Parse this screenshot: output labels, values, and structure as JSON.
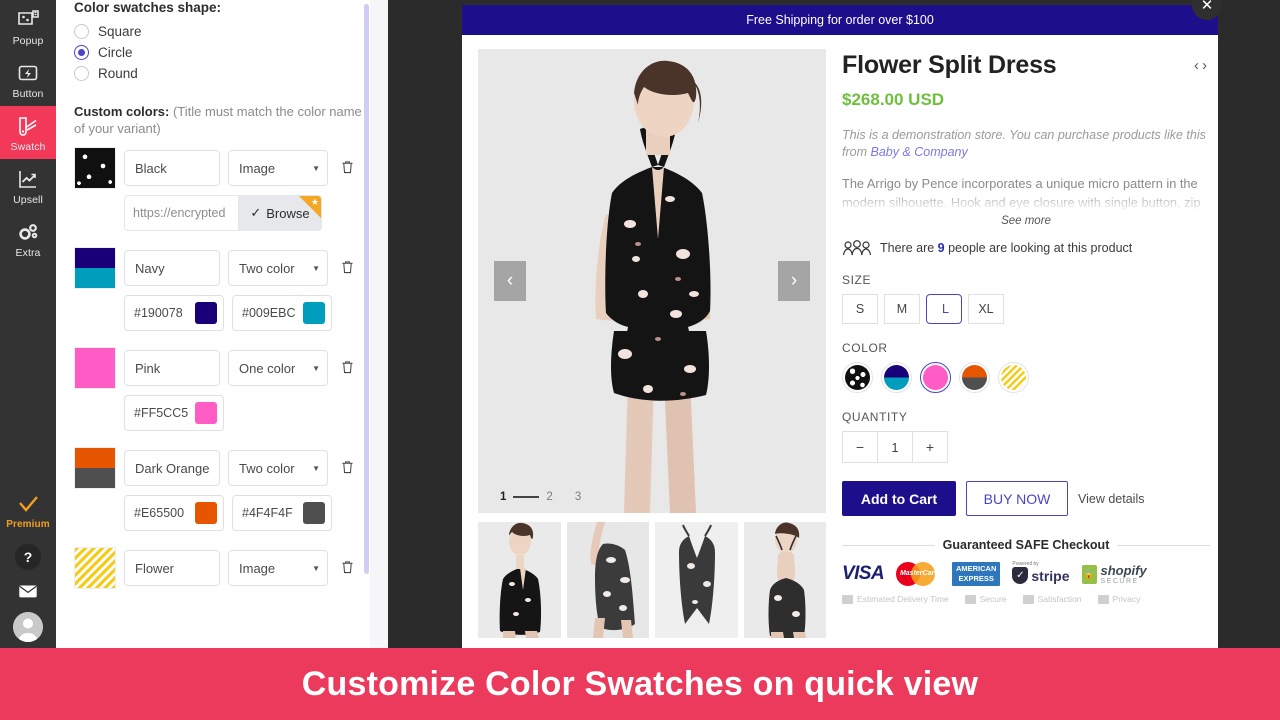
{
  "rail": {
    "items": [
      {
        "label": "Popup",
        "icon": "popup-icon",
        "active": false
      },
      {
        "label": "Button",
        "icon": "button-icon",
        "active": false
      },
      {
        "label": "Swatch",
        "icon": "swatch-icon",
        "active": true
      },
      {
        "label": "Upsell",
        "icon": "upsell-icon",
        "active": false
      },
      {
        "label": "Extra",
        "icon": "extra-icon",
        "active": false
      }
    ],
    "premium_label": "Premium",
    "help_label": "?",
    "active_color": "#f2395a",
    "premium_color": "#f0a020"
  },
  "panel": {
    "shape_title": "Color swatches shape:",
    "shape_options": [
      {
        "label": "Square",
        "selected": false
      },
      {
        "label": "Circle",
        "selected": true
      },
      {
        "label": "Round",
        "selected": false
      }
    ],
    "custom_label": "Custom colors:",
    "custom_hint": "(Title must match the color name of your variant)",
    "select_caret": "▼",
    "trash_icon": "🗑",
    "browse_label": "Browse",
    "browse_check": "✓",
    "rows": [
      {
        "title": "Black",
        "type": "Image",
        "preview": "black-flower-pattern",
        "url": "https://encrypted",
        "hex1": null,
        "hex2": null,
        "color1": "#111111",
        "color2": null
      },
      {
        "title": "Navy",
        "type": "Two color",
        "preview": "two-color",
        "url": null,
        "hex1": "#190078",
        "hex2": "#009EBC",
        "color1": "#190078",
        "color2": "#009EBC"
      },
      {
        "title": "Pink",
        "type": "One color",
        "preview": "one-color",
        "url": null,
        "hex1": "#FF5CC5",
        "hex2": null,
        "color1": "#FF5CC5",
        "color2": null
      },
      {
        "title": "Dark Orange",
        "type": "Two color",
        "preview": "two-color",
        "url": null,
        "hex1": "#E65500",
        "hex2": "#4F4F4F",
        "color1": "#E65500",
        "color2": "#4F4F4F"
      },
      {
        "title": "Flower",
        "type": "Image",
        "preview": "yellow-zigzag-pattern",
        "url": null,
        "hex1": null,
        "hex2": null,
        "color1": "#f5cc1a",
        "color2": null
      }
    ]
  },
  "modal": {
    "close_icon": "✕",
    "shipping_banner": "Free Shipping for order over $100",
    "gallery": {
      "prev_icon": "‹",
      "next_icon": "›",
      "pager": {
        "current": "1",
        "others": [
          "2",
          "3"
        ]
      },
      "thumbnails": [
        "front-full",
        "side-detail",
        "flat-lay",
        "back-view"
      ]
    },
    "product": {
      "title": "Flower Split Dress",
      "nav_prev": "‹",
      "nav_next": "›",
      "price": "$268.00 USD",
      "price_color": "#6fbf3f",
      "demo_text": "This is a demonstration store. You can purchase products like this from ",
      "demo_link": "Baby & Company",
      "description": "The Arrigo by Pence incorporates a unique micro pattern in the modern silhouette. Hook and eye closure with single button, zip fly",
      "see_more": "See more",
      "watchers_prefix": "There are ",
      "watchers_count": "9",
      "watchers_suffix": " people are looking at this product",
      "size_label": "SIZE",
      "sizes": [
        {
          "label": "S",
          "selected": false
        },
        {
          "label": "M",
          "selected": false
        },
        {
          "label": "L",
          "selected": true
        },
        {
          "label": "XL",
          "selected": false
        }
      ],
      "color_label": "COLOR",
      "colors": [
        {
          "name": "Black",
          "kind": "image-black-flower",
          "selected": false
        },
        {
          "name": "Navy",
          "kind": "two",
          "c1": "#190078",
          "c2": "#009EBC",
          "selected": false
        },
        {
          "name": "Pink",
          "kind": "one",
          "c1": "#FF5CC5",
          "selected": true
        },
        {
          "name": "Dark Orange",
          "kind": "two",
          "c1": "#E65500",
          "c2": "#4F4F4F",
          "selected": false
        },
        {
          "name": "Flower",
          "kind": "image-yellow-zigzag",
          "selected": false
        }
      ],
      "quantity_label": "QUANTITY",
      "qty_minus": "−",
      "qty_value": "1",
      "qty_plus": "+",
      "add_to_cart": "Add to Cart",
      "buy_now": "BUY NOW",
      "view_details": "View details",
      "safe_checkout": "Guaranteed SAFE Checkout",
      "payments": [
        "VISA",
        "MasterCard",
        "AMERICAN EXPRESS",
        "stripe",
        "shopify SECURE"
      ],
      "stripe_powered": "Powered by",
      "stripe_name": "stripe",
      "shopify_name": "shopify",
      "shopify_sub": "SECURE",
      "amex_l1": "AMERICAN",
      "amex_l2": "EXPRESS",
      "mc_name": "MasterCard",
      "trust_items": [
        "Estimated Delivery Time",
        "Secure",
        "Satisfaction",
        "Privacy"
      ]
    }
  },
  "caption": {
    "text": "Customize Color Swatches on quick view",
    "background": "#ec3a5c"
  }
}
